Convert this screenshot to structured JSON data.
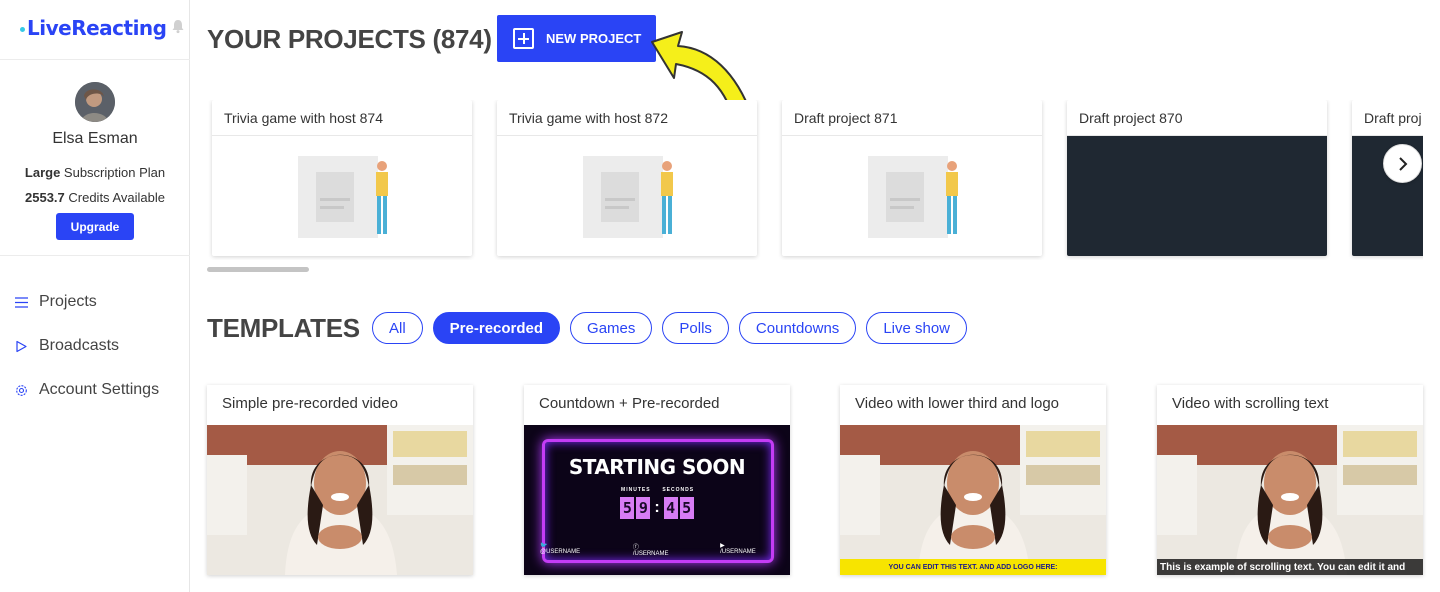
{
  "sidebar": {
    "logo": "LiveReacting",
    "user_name": "Elsa Esman",
    "plan_bold": "Large",
    "plan_text": " Subscription Plan",
    "credits_bold": "2553.7",
    "credits_text": " Credits Available",
    "upgrade_label": "Upgrade",
    "nav": [
      {
        "label": "Projects",
        "icon": "list-icon"
      },
      {
        "label": "Broadcasts",
        "icon": "play-icon"
      },
      {
        "label": "Account Settings",
        "icon": "gear-icon"
      }
    ]
  },
  "header": {
    "title": "YOUR PROJECTS (874)",
    "new_project_label": "NEW PROJECT"
  },
  "projects": [
    {
      "title": "Trivia game with host 874",
      "thumb": "placeholder"
    },
    {
      "title": "Trivia game with host 872",
      "thumb": "placeholder"
    },
    {
      "title": "Draft project 871",
      "thumb": "placeholder"
    },
    {
      "title": "Draft project 870",
      "thumb": "dark"
    },
    {
      "title": "Draft proj",
      "thumb": "dark"
    }
  ],
  "templates": {
    "title": "TEMPLATES",
    "filters": [
      {
        "label": "All",
        "active": false
      },
      {
        "label": "Pre-recorded",
        "active": true
      },
      {
        "label": "Games",
        "active": false
      },
      {
        "label": "Polls",
        "active": false
      },
      {
        "label": "Countdowns",
        "active": false
      },
      {
        "label": "Live show",
        "active": false
      }
    ],
    "items": [
      {
        "title": "Simple pre-recorded video"
      },
      {
        "title": "Countdown + Pre-recorded"
      },
      {
        "title": "Video with lower third and logo"
      },
      {
        "title": "Video with scrolling text"
      }
    ],
    "countdown": {
      "heading": "STARTING SOON",
      "minutes_label": "MINUTES",
      "seconds_label": "SECONDS",
      "digits": [
        "5",
        "9",
        "4",
        "5"
      ],
      "twitter": "@USERNAME",
      "facebook": "/USERNAME",
      "youtube": "/USERNAME"
    },
    "lower_third_text": "YOU CAN EDIT THIS TEXT. AND ADD LOGO HERE:",
    "scrolling_text": "This is example of scrolling text. You can edit it and"
  },
  "colors": {
    "accent": "#2a44f5",
    "arrow": "#f5ef1a",
    "lower_third": "#f7e400"
  }
}
